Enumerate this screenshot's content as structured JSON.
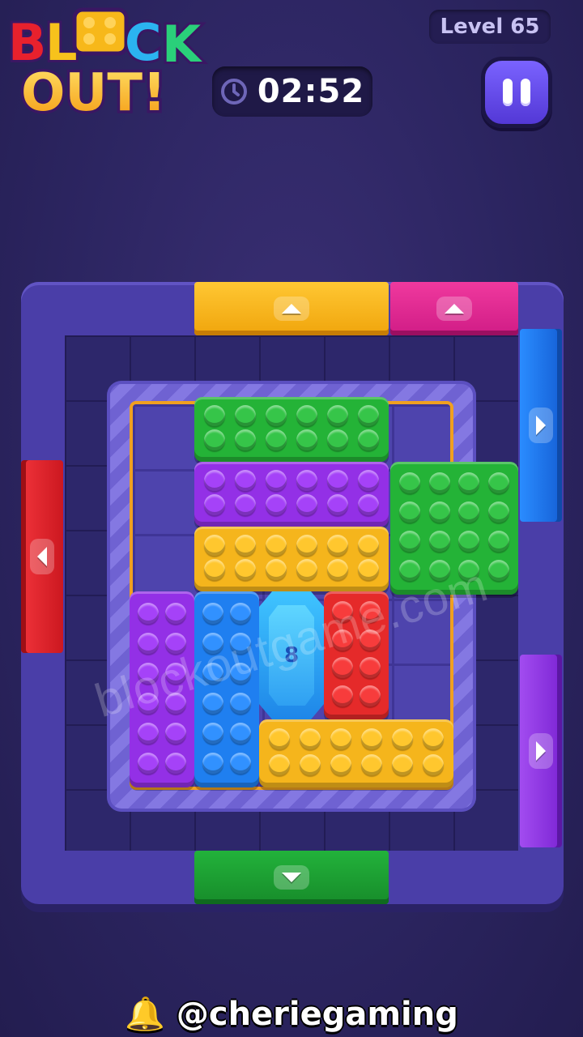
{
  "logo": {
    "line1": "BLOCK",
    "line2": "OUT!"
  },
  "header": {
    "level": "Level 65",
    "timer": "02:52"
  },
  "colors": {
    "yellow": "#f5b51c",
    "pink": "#e0259a",
    "blue": "#1f7ff0",
    "red": "#e52a2a",
    "purple": "#9330e6",
    "green": "#24b337"
  },
  "gem": {
    "number": "8"
  },
  "watermark": "blockoutgame.com",
  "credit": "@cheriegaming"
}
